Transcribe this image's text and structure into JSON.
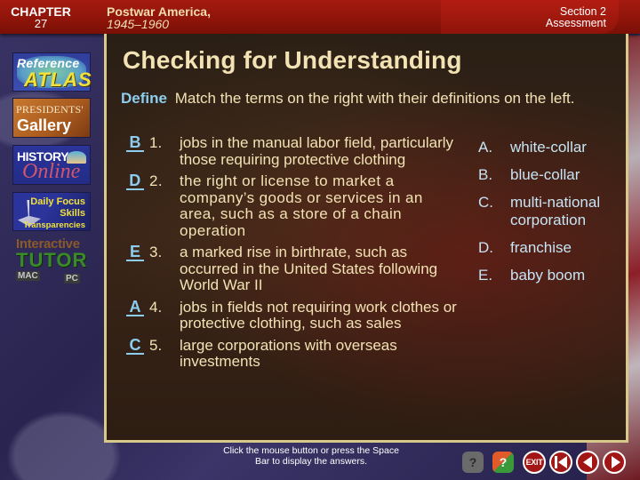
{
  "header": {
    "chapter_label": "CHAPTER",
    "chapter_number": "27",
    "book_title_line1": "Postwar America,",
    "book_title_line2": "1945–1960",
    "section_line1": "Section 2",
    "section_line2": "Assessment"
  },
  "sidebar": {
    "reference_atlas": {
      "line1": "Reference",
      "line2": "ATLAS"
    },
    "presidents_gallery": {
      "line1": "PRESIDENTS'",
      "line2": "Gallery"
    },
    "history_online": {
      "line1": "HISTORY",
      "line2": "Online"
    },
    "daily_focus": {
      "line1": "Daily Focus",
      "line2": "Skills",
      "line3": "Transparencies"
    },
    "interactive_tutor": {
      "line1": "Interactive",
      "line2": "TUTOR",
      "mac": "MAC",
      "pc": "PC"
    }
  },
  "slide": {
    "title": "Checking for Understanding",
    "instruction_keyword": "Define",
    "instruction_text": "Match the terms on the right with their definitions on the left.",
    "definitions": [
      {
        "answer": "B",
        "number": "1.",
        "text": "jobs in the manual labor field, particularly those requiring protective clothing"
      },
      {
        "answer": "D",
        "number": "2.",
        "text": "the right or license to market a company’s goods or services in an area, such as a store of a chain operation"
      },
      {
        "answer": "E",
        "number": "3.",
        "text": "a marked rise in birthrate, such as occurred in the United States following World War II"
      },
      {
        "answer": "A",
        "number": "4.",
        "text": "jobs in fields not requiring work clothes or protective clothing, such as sales"
      },
      {
        "answer": "C",
        "number": "5.",
        "text": "large corporations with overseas investments"
      }
    ],
    "terms": [
      {
        "letter": "A.",
        "text": "white-collar"
      },
      {
        "letter": "B.",
        "text": "blue-collar"
      },
      {
        "letter": "C.",
        "text": "multi-national corporation"
      },
      {
        "letter": "D.",
        "text": "franchise"
      },
      {
        "letter": "E.",
        "text": "baby boom"
      }
    ]
  },
  "footer": {
    "hint": "Click the mouse button or press the Space Bar to display the answers.",
    "mac_help": "?",
    "pc_help": "?",
    "exit_label": "EXIT",
    "icons": [
      "mac-help-icon",
      "pc-help-icon",
      "exit-icon",
      "first-slide-icon",
      "previous-slide-icon",
      "next-slide-icon"
    ]
  },
  "colors": {
    "header_red": "#8e1409",
    "title_cream": "#f2e2b4",
    "keyword_blue": "#8ccdf0",
    "term_blue": "#c6e4f4",
    "panel_border_gold": "#d8c88a"
  }
}
